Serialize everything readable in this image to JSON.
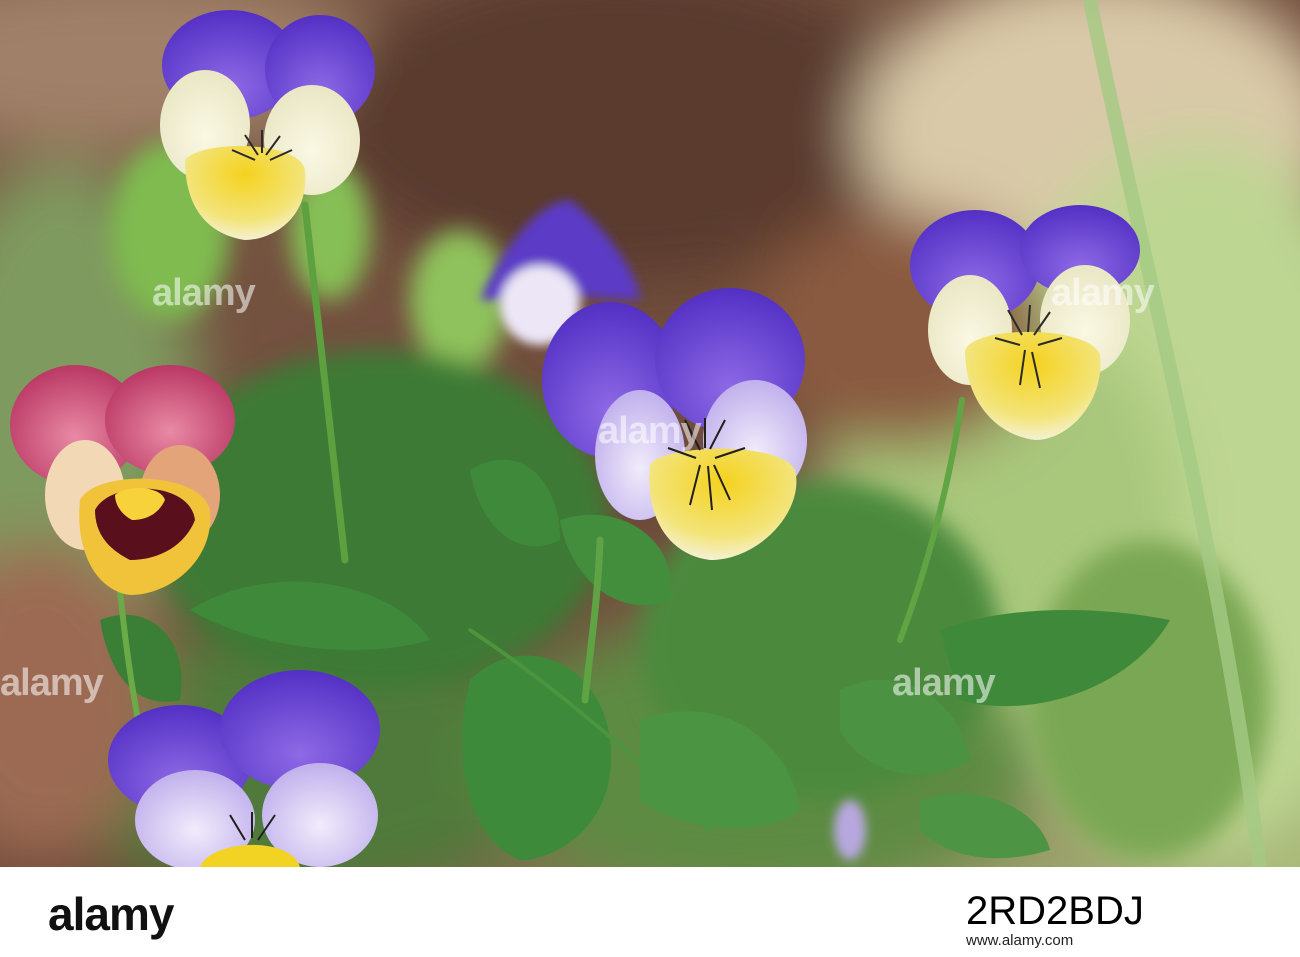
{
  "watermark": {
    "text": "alamy",
    "color": "#ffffff"
  },
  "footer": {
    "logo_text": "alamy",
    "image_id": "2RD2BDJ",
    "url": "www.alamy.com"
  },
  "scene": {
    "subject": "pansies",
    "colors": {
      "purple": "#6a3fd0",
      "pale_lavender": "#e6ddf5",
      "cream": "#f6f2d8",
      "yellow": "#f3d930",
      "pink": "#c8406e",
      "leaf": "#3f8a3a",
      "soil": "#6b4330",
      "light_green": "#bcd78a"
    }
  }
}
